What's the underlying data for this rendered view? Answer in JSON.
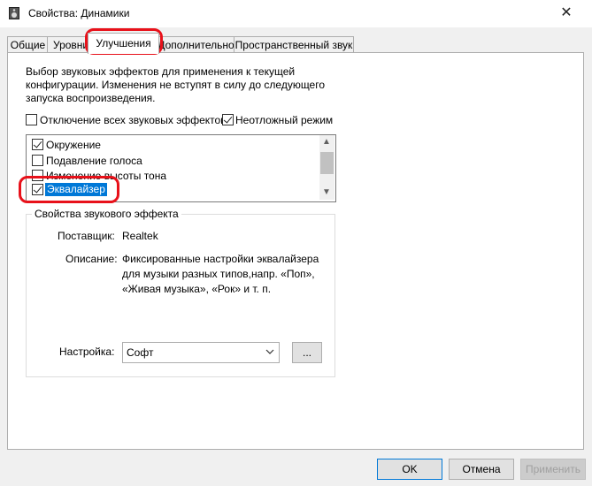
{
  "window": {
    "title": "Свойства: Динамики",
    "close": "✕"
  },
  "tabs": [
    {
      "label": "Общие"
    },
    {
      "label": "Уровни"
    },
    {
      "label": "Улучшения"
    },
    {
      "label": "Дополнительно"
    },
    {
      "label": "Пространственный звук"
    }
  ],
  "enhancements": {
    "description": "Выбор звуковых эффектов для применения к текущей конфигурации. Изменения не вступят в силу до следующего запуска воспроизведения.",
    "disable_all": {
      "label": "Отключение всех звуковых эффектов",
      "checked": false
    },
    "immediate_mode": {
      "label": "Неотложный режим",
      "checked": true
    },
    "effects": [
      {
        "label": "Окружение",
        "checked": true
      },
      {
        "label": "Подавление голоса",
        "checked": false
      },
      {
        "label": "Изменение высоты тона",
        "checked": false
      },
      {
        "label": "Эквалайзер",
        "checked": true,
        "selected": true
      }
    ]
  },
  "properties": {
    "group_title": "Свойства звукового эффекта",
    "provider_label": "Поставщик:",
    "provider_value": "Realtek",
    "description_label": "Описание:",
    "description_value": "Фиксированные настройки эквалайзера для музыки разных типов,напр. «Поп», «Живая музыка», «Рок» и т. п.",
    "setting_label": "Настройка:",
    "setting_value": "Софт",
    "more_button": "..."
  },
  "buttons": {
    "ok": "OK",
    "cancel": "Отмена",
    "apply": "Применить"
  },
  "colors": {
    "highlight": "#0078d7",
    "annotation_ring": "#e8111a",
    "default_button_border": "#0078d7"
  }
}
